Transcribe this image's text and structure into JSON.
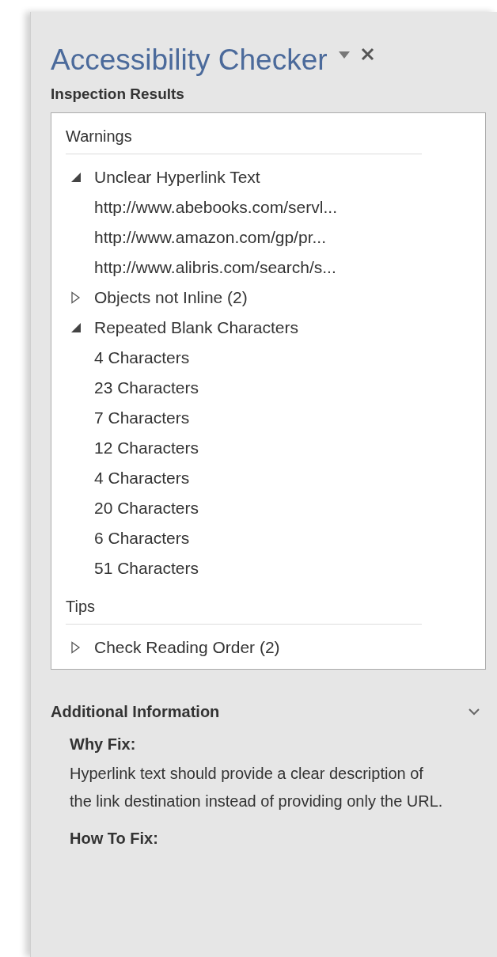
{
  "pane": {
    "title": "Accessibility Checker",
    "subtitle": "Inspection Results"
  },
  "sections": [
    {
      "title": "Warnings",
      "items": [
        {
          "label": "Unclear Hyperlink Text",
          "expanded": true,
          "children": [
            {
              "label": "http://www.abebooks.com/servl..."
            },
            {
              "label": "http://www.amazon.com/gp/pr..."
            },
            {
              "label": "http://www.alibris.com/search/s..."
            }
          ]
        },
        {
          "label": "Objects not Inline (2)",
          "expanded": false
        },
        {
          "label": "Repeated Blank Characters",
          "expanded": true,
          "children": [
            {
              "label": "4 Characters"
            },
            {
              "label": "23 Characters"
            },
            {
              "label": "7 Characters"
            },
            {
              "label": "12 Characters"
            },
            {
              "label": "4 Characters"
            },
            {
              "label": "20 Characters"
            },
            {
              "label": "6 Characters"
            },
            {
              "label": "51 Characters"
            }
          ]
        }
      ]
    },
    {
      "title": "Tips",
      "items": [
        {
          "label": "Check Reading Order (2)",
          "expanded": false
        }
      ]
    }
  ],
  "additional": {
    "title": "Additional Information",
    "expanded": true,
    "blocks": [
      {
        "heading": "Why Fix:",
        "text": "Hyperlink text should provide a clear description of the link destination instead of providing only the URL."
      },
      {
        "heading": "How To Fix:"
      }
    ]
  }
}
